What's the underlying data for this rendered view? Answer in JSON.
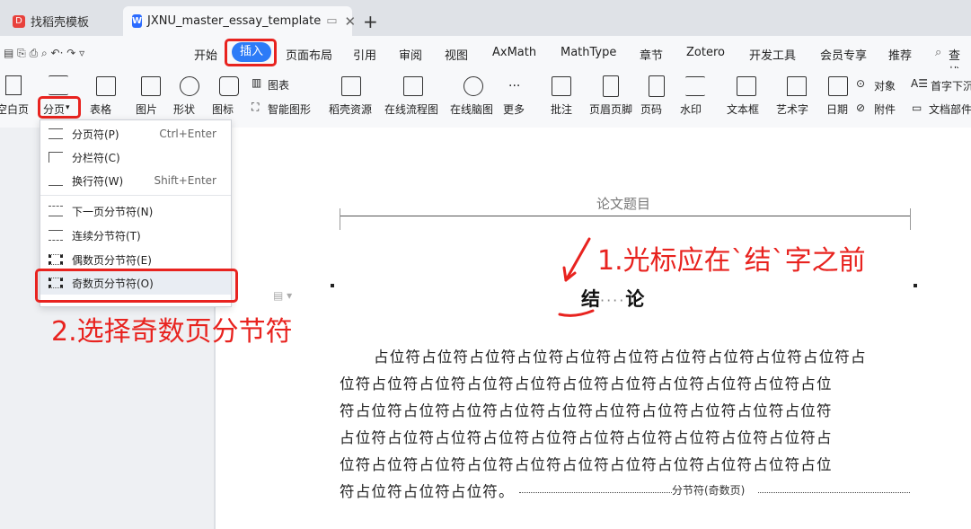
{
  "tabs": {
    "tab1_label": "找稻壳模板",
    "tab2_label": "JXNU_master_essay_template",
    "new_tab": "+"
  },
  "menu": {
    "items": [
      "开始",
      "插入",
      "页面布局",
      "引用",
      "审阅",
      "视图",
      "AxMath",
      "MathType",
      "章节",
      "Zotero",
      "开发工具",
      "会员专享",
      "推荐",
      "查找"
    ]
  },
  "ribbon": {
    "blank_page": "空白页",
    "page_break": "分页",
    "table": "表格",
    "picture": "图片",
    "shape": "形状",
    "icon": "图标",
    "chart": "图表",
    "smart_art": "智能图形",
    "resource": "稻壳资源",
    "flowchart": "在线流程图",
    "mindmap": "在线脑图",
    "more": "更多",
    "comment": "批注",
    "header_footer": "页眉页脚",
    "page_number": "页码",
    "watermark": "水印",
    "textbox": "文本框",
    "wordart": "艺术字",
    "date": "日期",
    "object": "对象",
    "attachment": "附件",
    "dropcap": "首字下沉",
    "docparts": "文档部件"
  },
  "dropdown": {
    "items": [
      {
        "label": "分页符(P)",
        "shortcut": "Ctrl+Enter"
      },
      {
        "label": "分栏符(C)",
        "shortcut": ""
      },
      {
        "label": "换行符(W)",
        "shortcut": "Shift+Enter"
      },
      {
        "label": "下一页分节符(N)",
        "shortcut": ""
      },
      {
        "label": "连续分节符(T)",
        "shortcut": ""
      },
      {
        "label": "偶数页分节符(E)",
        "shortcut": ""
      },
      {
        "label": "奇数页分节符(O)",
        "shortcut": ""
      }
    ]
  },
  "annotations": {
    "step1": "1.光标应在`结`字之前",
    "step2": "2.选择奇数页分节符"
  },
  "document": {
    "header": "论文题目",
    "title_char1": "结",
    "title_dots": "····",
    "title_char2": "论",
    "body_lines": [
      "占位符占位符占位符占位符占位符占位符占位符占位符占位符占位符占",
      "位符占位符占位符占位符占位符占位符占位符占位符占位符占位符占位",
      "符占位符占位符占位符占位符占位符占位符占位符占位符占位符占位符",
      "占位符占位符占位符占位符占位符占位符占位符占位符占位符占位符占",
      "位符占位符占位符占位符占位符占位符占位符占位符占位符占位符占位",
      "符占位符占位符占位符。"
    ],
    "section_break": "分节符(奇数页)"
  },
  "colors": {
    "accent": "#2d7bf7",
    "annotation": "#e8231f"
  }
}
